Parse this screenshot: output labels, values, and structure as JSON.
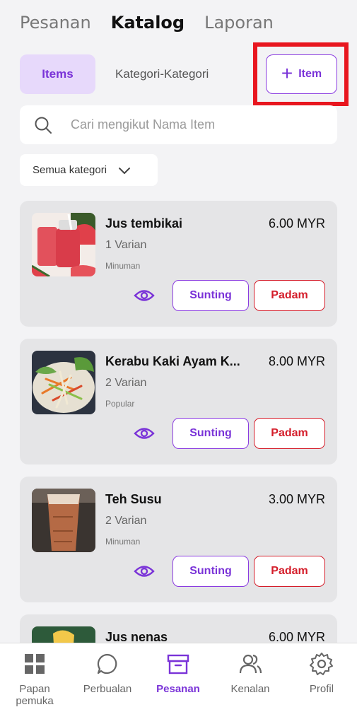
{
  "top_tabs": [
    "Pesanan",
    "Katalog",
    "Laporan"
  ],
  "segments": {
    "items": "Items",
    "categories": "Kategori-Kategori"
  },
  "add_button": {
    "plus": "+",
    "label": "Item"
  },
  "search": {
    "placeholder": "Cari mengikut Nama Item"
  },
  "filter": {
    "label": "Semua kategori"
  },
  "items": [
    {
      "name": "Jus tembikai",
      "price": "6.00 MYR",
      "variants": "1 Varian",
      "category": "Minuman",
      "edit": "Sunting",
      "delete": "Padam"
    },
    {
      "name": "Kerabu Kaki Ayam K...",
      "price": "8.00 MYR",
      "variants": "2 Varian",
      "category": "Popular",
      "edit": "Sunting",
      "delete": "Padam"
    },
    {
      "name": "Teh Susu",
      "price": "3.00 MYR",
      "variants": "2 Varian",
      "category": "Minuman",
      "edit": "Sunting",
      "delete": "Padam"
    },
    {
      "name": "Jus nenas",
      "price": "6.00 MYR"
    }
  ],
  "bottom_nav": [
    {
      "label": "Papan pemuka",
      "icon": "dashboard-icon"
    },
    {
      "label": "Perbualan",
      "icon": "chat-icon"
    },
    {
      "label": "Pesanan",
      "icon": "archive-box-icon",
      "active": true
    },
    {
      "label": "Kenalan",
      "icon": "contacts-icon"
    },
    {
      "label": "Profil",
      "icon": "gear-icon"
    }
  ],
  "colors": {
    "accent": "#7a33d8",
    "danger": "#d41d2a",
    "highlight": "#e8161f"
  }
}
